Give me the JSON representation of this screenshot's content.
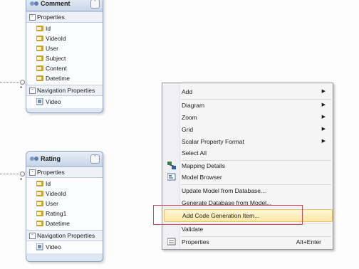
{
  "entities": {
    "comment": {
      "title": "Comment",
      "properties_label": "Properties",
      "properties": [
        "Id",
        "VideoId",
        "User",
        "Subject",
        "Content",
        "Datetime"
      ],
      "nav_label": "Navigation Properties",
      "nav": [
        "Video"
      ]
    },
    "rating": {
      "title": "Rating",
      "properties_label": "Properties",
      "properties": [
        "Id",
        "VideoId",
        "User",
        "Rating1",
        "Datetime"
      ],
      "nav_label": "Navigation Properties",
      "nav": [
        "Video"
      ]
    }
  },
  "multiplicity": "*",
  "context_menu": {
    "items": [
      {
        "label": "Add",
        "submenu": true
      },
      {
        "label": "Diagram",
        "submenu": true
      },
      {
        "label": "Zoom",
        "submenu": true
      },
      {
        "label": "Grid",
        "submenu": true
      },
      {
        "label": "Scalar Property Format",
        "submenu": true
      },
      {
        "label": "Select All"
      },
      {
        "label": "Mapping Details",
        "icon": "mapping-icon"
      },
      {
        "label": "Model Browser",
        "icon": "model-browser-icon"
      },
      {
        "label": "Update Model from Database..."
      },
      {
        "label": "Generate Database from Model..."
      },
      {
        "label": "Add Code Generation Item...",
        "highlighted": true
      },
      {
        "label": "Validate"
      },
      {
        "label": "Properties",
        "icon": "properties-icon",
        "shortcut": "Alt+Enter"
      }
    ],
    "colors": {
      "highlight": "#fbe9a6",
      "annotation_box": "#d24a5e"
    }
  }
}
